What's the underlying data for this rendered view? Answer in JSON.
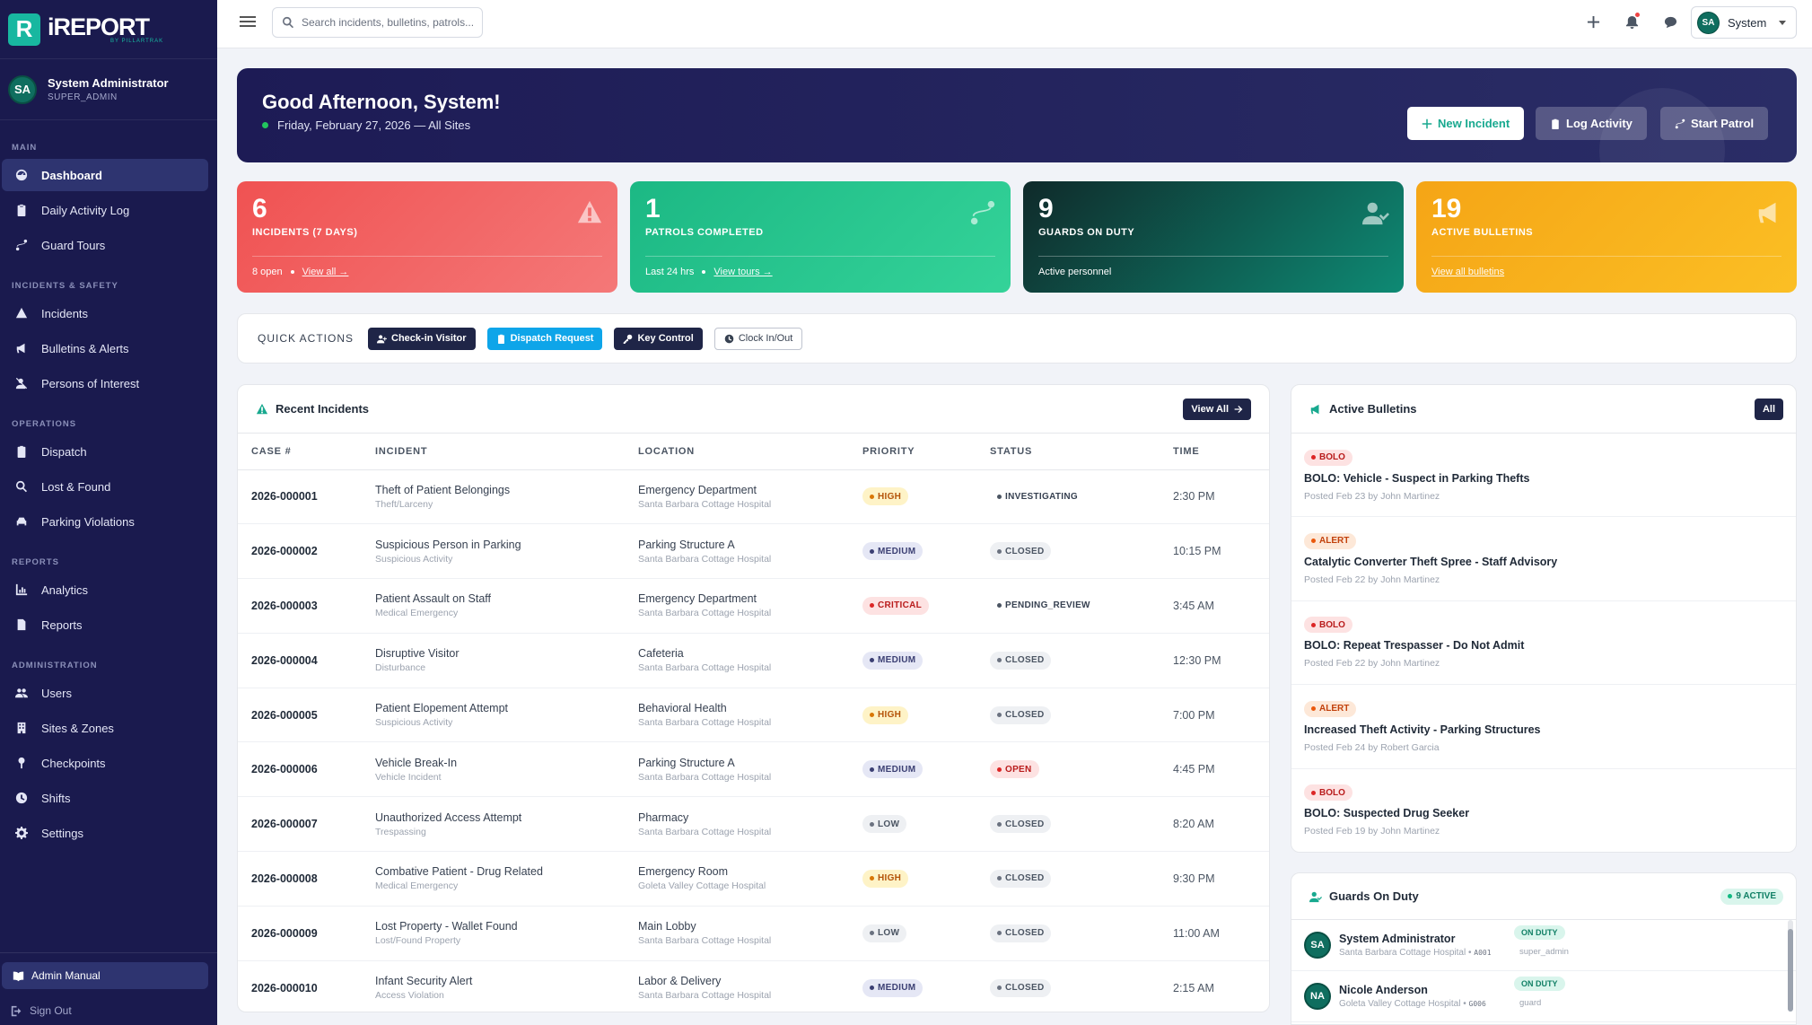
{
  "brand": {
    "logo_letter": "R",
    "name": "iREPORT",
    "sub": "BY PILLARTRAK"
  },
  "sidebar": {
    "user_initials": "SA",
    "user_name": "System Administrator",
    "user_role": "SUPER_ADMIN",
    "sections": [
      {
        "label": "MAIN"
      },
      {
        "label": "INCIDENTS & SAFETY"
      },
      {
        "label": "OPERATIONS"
      },
      {
        "label": "REPORTS"
      },
      {
        "label": "ADMINISTRATION"
      }
    ],
    "items": [
      {
        "label": "Dashboard",
        "icon": "dashboard-icon"
      },
      {
        "label": "Daily Activity Log",
        "icon": "clipboard-icon"
      },
      {
        "label": "Guard Tours",
        "icon": "route-icon"
      },
      {
        "label": "Incidents",
        "icon": "warning-icon"
      },
      {
        "label": "Bulletins & Alerts",
        "icon": "megaphone-icon"
      },
      {
        "label": "Persons of Interest",
        "icon": "user-slash-icon"
      },
      {
        "label": "Dispatch",
        "icon": "clipboard-list-icon"
      },
      {
        "label": "Lost & Found",
        "icon": "search-icon"
      },
      {
        "label": "Parking Violations",
        "icon": "car-icon"
      },
      {
        "label": "Analytics",
        "icon": "chart-icon"
      },
      {
        "label": "Reports",
        "icon": "file-icon"
      },
      {
        "label": "Users",
        "icon": "users-icon"
      },
      {
        "label": "Sites & Zones",
        "icon": "building-icon"
      },
      {
        "label": "Checkpoints",
        "icon": "pin-icon"
      },
      {
        "label": "Shifts",
        "icon": "clock-icon"
      },
      {
        "label": "Settings",
        "icon": "gear-icon"
      }
    ],
    "admin_manual": "Admin Manual",
    "sign_out": "Sign Out"
  },
  "topbar": {
    "search_placeholder": "Search incidents, bulletins, patrols...",
    "user_initials": "SA",
    "user_label": "System"
  },
  "hero": {
    "title": "Good Afternoon, System!",
    "subtitle": "Friday, February 27, 2026 — All Sites",
    "btn_new_incident": "New Incident",
    "btn_log_activity": "Log Activity",
    "btn_start_patrol": "Start Patrol"
  },
  "stats": [
    {
      "value": "6",
      "label": "INCIDENTS (7 DAYS)",
      "foot_text": "8 open",
      "foot_link": "View all →",
      "color": "#ef5050"
    },
    {
      "value": "1",
      "label": "PATROLS COMPLETED",
      "foot_text": "Last 24 hrs",
      "foot_link": "View tours →",
      "color": "#1fbf8a"
    },
    {
      "value": "9",
      "label": "GUARDS ON DUTY",
      "foot_text": "Active personnel",
      "foot_link": "",
      "color": "#0f5f57"
    },
    {
      "value": "19",
      "label": "ACTIVE BULLETINS",
      "foot_text": "",
      "foot_link": "View all bulletins",
      "color": "#f5a91b"
    }
  ],
  "quick_actions": {
    "label": "QUICK ACTIONS",
    "items": [
      "Check-in Visitor",
      "Dispatch Request",
      "Key Control",
      "Clock In/Out"
    ]
  },
  "recent_incidents": {
    "title": "Recent Incidents",
    "view_all": "View All",
    "columns": [
      "CASE #",
      "INCIDENT",
      "LOCATION",
      "PRIORITY",
      "STATUS",
      "TIME"
    ],
    "rows": [
      {
        "case": "2026-000001",
        "incident": "Theft of Patient Belongings",
        "type": "Theft/Larceny",
        "location": "Emergency Department",
        "site": "Santa Barbara Cottage Hospital",
        "priority": "HIGH",
        "status": "INVESTIGATING",
        "time": "2:30 PM"
      },
      {
        "case": "2026-000002",
        "incident": "Suspicious Person in Parking",
        "type": "Suspicious Activity",
        "location": "Parking Structure A",
        "site": "Santa Barbara Cottage Hospital",
        "priority": "MEDIUM",
        "status": "CLOSED",
        "time": "10:15 PM"
      },
      {
        "case": "2026-000003",
        "incident": "Patient Assault on Staff",
        "type": "Medical Emergency",
        "location": "Emergency Department",
        "site": "Santa Barbara Cottage Hospital",
        "priority": "CRITICAL",
        "status": "PENDING_REVIEW",
        "time": "3:45 AM"
      },
      {
        "case": "2026-000004",
        "incident": "Disruptive Visitor",
        "type": "Disturbance",
        "location": "Cafeteria",
        "site": "Santa Barbara Cottage Hospital",
        "priority": "MEDIUM",
        "status": "CLOSED",
        "time": "12:30 PM"
      },
      {
        "case": "2026-000005",
        "incident": "Patient Elopement Attempt",
        "type": "Suspicious Activity",
        "location": "Behavioral Health",
        "site": "Santa Barbara Cottage Hospital",
        "priority": "HIGH",
        "status": "CLOSED",
        "time": "7:00 PM"
      },
      {
        "case": "2026-000006",
        "incident": "Vehicle Break-In",
        "type": "Vehicle Incident",
        "location": "Parking Structure A",
        "site": "Santa Barbara Cottage Hospital",
        "priority": "MEDIUM",
        "status": "OPEN",
        "time": "4:45 PM"
      },
      {
        "case": "2026-000007",
        "incident": "Unauthorized Access Attempt",
        "type": "Trespassing",
        "location": "Pharmacy",
        "site": "Santa Barbara Cottage Hospital",
        "priority": "LOW",
        "status": "CLOSED",
        "time": "8:20 AM"
      },
      {
        "case": "2026-000008",
        "incident": "Combative Patient - Drug Related",
        "type": "Medical Emergency",
        "location": "Emergency Room",
        "site": "Goleta Valley Cottage Hospital",
        "priority": "HIGH",
        "status": "CLOSED",
        "time": "9:30 PM"
      },
      {
        "case": "2026-000009",
        "incident": "Lost Property - Wallet Found",
        "type": "Lost/Found Property",
        "location": "Main Lobby",
        "site": "Santa Barbara Cottage Hospital",
        "priority": "LOW",
        "status": "CLOSED",
        "time": "11:00 AM"
      },
      {
        "case": "2026-000010",
        "incident": "Infant Security Alert",
        "type": "Access Violation",
        "location": "Labor & Delivery",
        "site": "Santa Barbara Cottage Hospital",
        "priority": "MEDIUM",
        "status": "CLOSED",
        "time": "2:15 AM"
      }
    ]
  },
  "bulletins": {
    "title": "Active Bulletins",
    "all_label": "All",
    "items": [
      {
        "tag": "BOLO",
        "title": "BOLO: Vehicle - Suspect in Parking Thefts",
        "meta": "Posted Feb 23 by John Martinez"
      },
      {
        "tag": "ALERT",
        "title": "Catalytic Converter Theft Spree - Staff Advisory",
        "meta": "Posted Feb 22 by John Martinez"
      },
      {
        "tag": "BOLO",
        "title": "BOLO: Repeat Trespasser - Do Not Admit",
        "meta": "Posted Feb 22 by John Martinez"
      },
      {
        "tag": "ALERT",
        "title": "Increased Theft Activity - Parking Structures",
        "meta": "Posted Feb 24 by Robert Garcia"
      },
      {
        "tag": "BOLO",
        "title": "BOLO: Suspected Drug Seeker",
        "meta": "Posted Feb 19 by John Martinez"
      }
    ]
  },
  "guards": {
    "title": "Guards On Duty",
    "active_badge": "9 ACTIVE",
    "items": [
      {
        "initials": "SA",
        "name": "System Administrator",
        "site": "Santa Barbara Cottage Hospital",
        "code": "A001",
        "status": "ON DUTY",
        "role": "super_admin"
      },
      {
        "initials": "NA",
        "name": "Nicole Anderson",
        "site": "Goleta Valley Cottage Hospital",
        "code": "G006",
        "status": "ON DUTY",
        "role": "guard"
      }
    ]
  }
}
